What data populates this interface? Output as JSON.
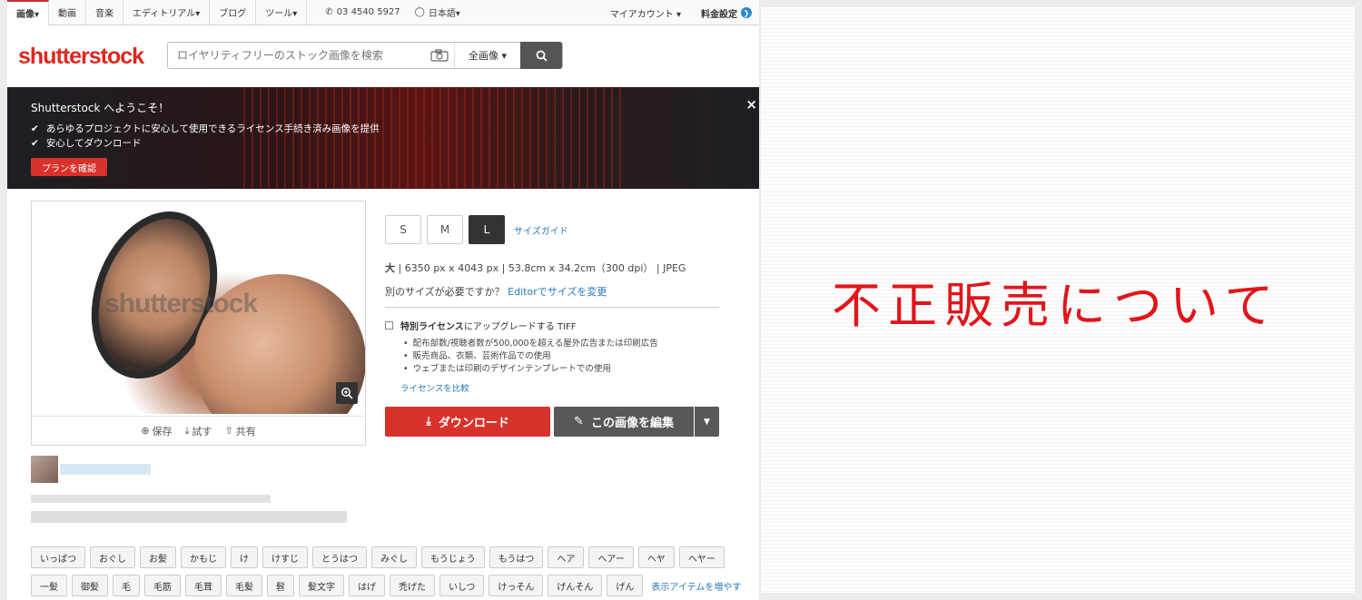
{
  "nav": {
    "tabs": [
      "画像▾",
      "動画",
      "音楽",
      "エディトリアル▾",
      "ブログ",
      "ツール▾"
    ],
    "phone": "03 4540 5927",
    "language": "日本語▾",
    "account": "マイアカウント ▾",
    "pricing": "料金設定"
  },
  "header": {
    "logo": "shutterstock",
    "search_placeholder": "ロイヤリティフリーのストック画像を検索",
    "scope": "全画像 ▾"
  },
  "banner": {
    "title": "Shutterstock へようこそ！",
    "point1": "あらゆるプロジェクトに安心して使用できるライセンス手続き済み画像を提供",
    "point2": "安心してダウンロード",
    "button": "プランを確認",
    "close": "×"
  },
  "image": {
    "watermark": "shutterstock",
    "save": "保存",
    "try": "試す",
    "share": "共有"
  },
  "sizes": {
    "options": [
      "S",
      "M",
      "L"
    ],
    "selected": "L",
    "guide": "サイズガイド"
  },
  "specs": {
    "size_label": "大",
    "pixels": "6350 px x 4043 px",
    "cm": "53.8cm x 34.2cm（300 dpi）",
    "format": "JPEG"
  },
  "other_size": {
    "text": "別のサイズが必要ですか？",
    "link_editor": "Editor",
    "link_tail": "でサイズを変更"
  },
  "license": {
    "bold": "特別ライセンス",
    "text": "にアップグレードする TIFF",
    "bullets": [
      "配布部数/視聴者数が500,000を超える屋外広告または印刷広告",
      "販売商品、衣類、芸術作品での使用",
      "ウェブまたは印刷のデザインテンプレートでの使用"
    ],
    "compare": "ライセンスを比較"
  },
  "actions": {
    "download": "ダウンロード",
    "edit": "この画像を編集"
  },
  "tags": {
    "row1": [
      "いっぱつ",
      "おぐし",
      "お髪",
      "かもじ",
      "け",
      "けすじ",
      "とうはつ",
      "みぐし",
      "もうじょう",
      "もうはつ",
      "ヘア",
      "ヘアー",
      "ヘヤ",
      "ヘヤー"
    ],
    "row2": [
      "一髪",
      "御髪",
      "毛",
      "毛筋",
      "毛茸",
      "毛髪",
      "髫",
      "髪文字",
      "はげ",
      "禿げた",
      "いしつ",
      "けっそん",
      "げんそん",
      "げん"
    ],
    "more": "表示アイテムを増やす"
  },
  "right": {
    "title": "不正販売について"
  }
}
